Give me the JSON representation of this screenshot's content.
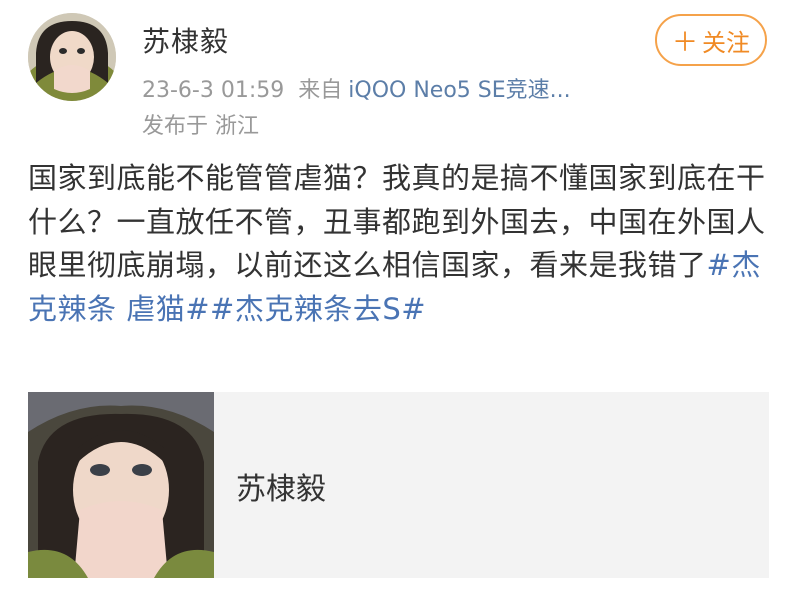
{
  "header": {
    "username": "苏棣毅",
    "timestamp": "23-6-3 01:59",
    "source_label": "来自",
    "device": "iQOO Neo5 SE竞速...",
    "location": "发布于 浙江",
    "follow_label": "关注",
    "follow_icon": "plus-icon"
  },
  "post": {
    "text": "国家到底能不能管管虐猫？我真的是搞不懂国家到底在干什么？一直放任不管，丑事都跑到外国去，中国在外国人眼里彻底崩塌，以前还这么相信国家，看来是我错了",
    "tag1": "#杰克辣条 虐猫#",
    "tag2": "#杰克辣条去S#"
  },
  "card": {
    "title": "苏棣毅"
  },
  "colors": {
    "accent": "#f08a24",
    "link": "#4a74b4",
    "meta": "#999999",
    "device_link": "#5c7ea8"
  }
}
